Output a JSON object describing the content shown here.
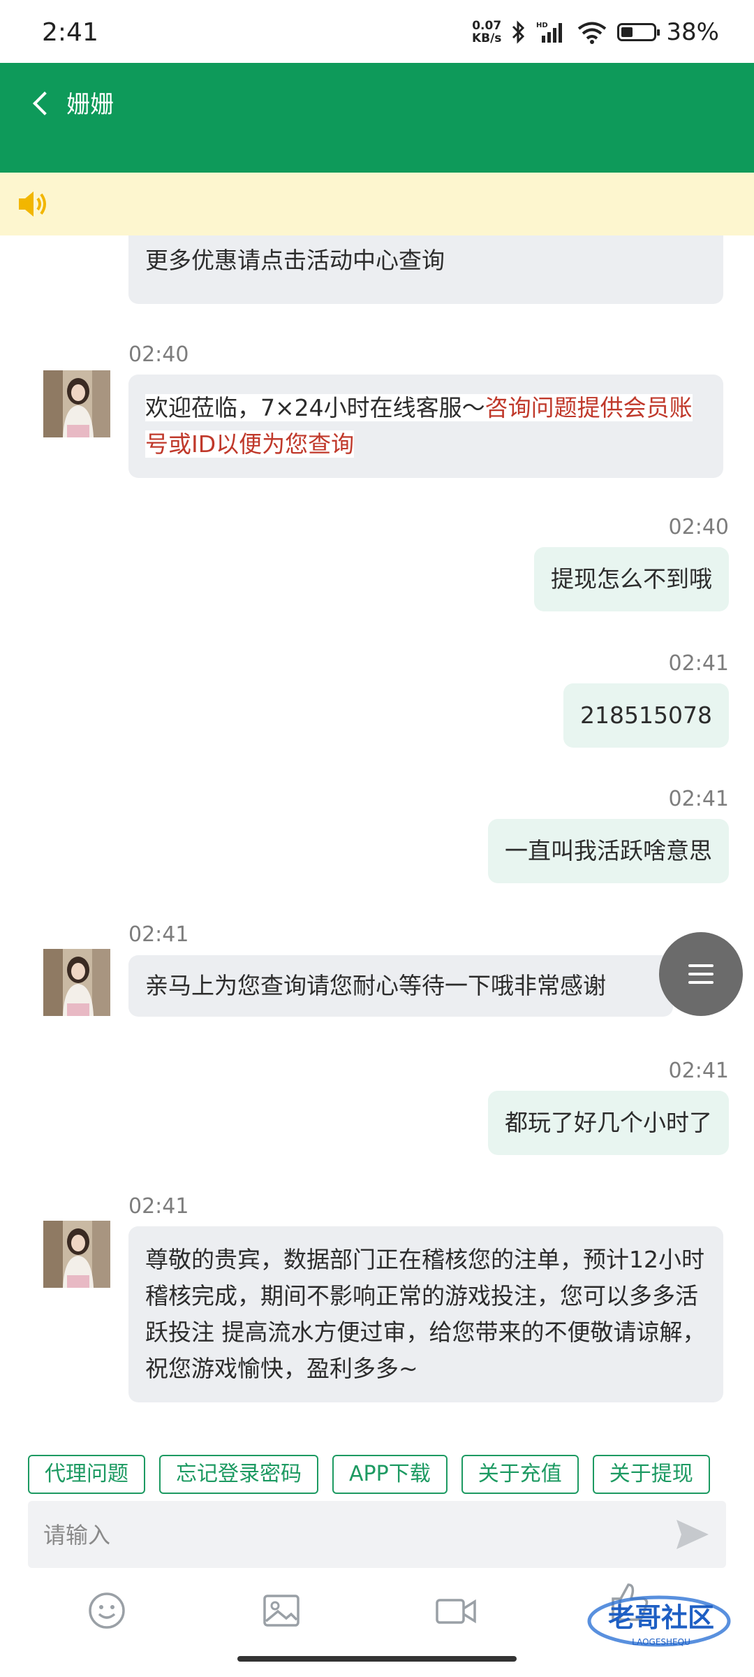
{
  "status_bar": {
    "time": "2:41",
    "net_speed_value": "0.07",
    "net_speed_unit": "KB/s",
    "battery": "38%"
  },
  "header": {
    "title": "姗姗"
  },
  "messages": {
    "m0": {
      "line": "更多优惠请点击活动中心查询"
    },
    "m1": {
      "time": "02:40",
      "text_plain": "欢迎莅临，7×24小时在线客服～",
      "text_red_1": "咨询问题提供会员账",
      "text_red_2": "号或ID以便为您查询"
    },
    "m2": {
      "time": "02:40",
      "text": "提现怎么不到哦"
    },
    "m3": {
      "time": "02:41",
      "text": "218515078"
    },
    "m4": {
      "time": "02:41",
      "text": "一直叫我活跃啥意思"
    },
    "m5": {
      "time": "02:41",
      "text": "亲马上为您查询请您耐心等待一下哦非常感谢"
    },
    "m6": {
      "time": "02:41",
      "text": "都玩了好几个小时了"
    },
    "m7": {
      "time": "02:41",
      "text": "尊敬的贵宾，数据部门正在稽核您的注单，预计12小时稽核完成，期间不影响正常的游戏投注，您可以多多活跃投注 提高流水方便过审，给您带来的不便敬请谅解，祝您游戏愉快，盈利多多~"
    }
  },
  "quick_replies": [
    "代理问题",
    "忘记登录密码",
    "APP下载",
    "关于充值",
    "关于提现"
  ],
  "input": {
    "placeholder": "请输入"
  },
  "watermark": {
    "text": "老哥社区",
    "sub": "LAOGESHEQU"
  },
  "colors": {
    "header_green": "#0e9a5a",
    "notice_yellow": "#fdf6cf",
    "highlight_red": "#c0392b",
    "quick_green": "#1d9a62"
  },
  "icons": {
    "back": "chevron-left-icon",
    "notice": "speaker-icon",
    "send": "send-icon",
    "emoji": "emoji-icon",
    "image": "image-icon",
    "video": "video-icon",
    "like": "thumbs-up-icon",
    "menu": "menu-icon"
  }
}
